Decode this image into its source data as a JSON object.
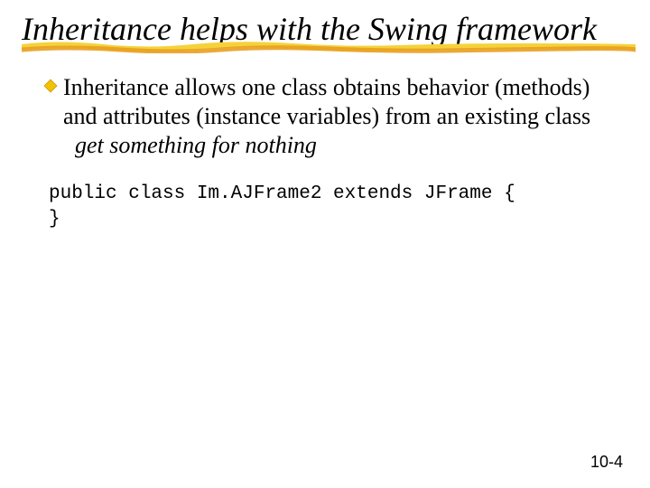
{
  "title": "Inheritance helps with the Swing framework",
  "bullet": {
    "text_main": "Inheritance allows one class obtains behavior (methods) and attributes (instance variables) from an existing class",
    "text_em": "get something for nothing"
  },
  "code": {
    "line1": "public class Im.AJFrame2 extends JFrame {",
    "line2": "}"
  },
  "page_number": "10-4",
  "colors": {
    "bullet_fill": "#f2c200",
    "underline_top": "#f6d23a",
    "underline_bot": "#e8a020"
  }
}
